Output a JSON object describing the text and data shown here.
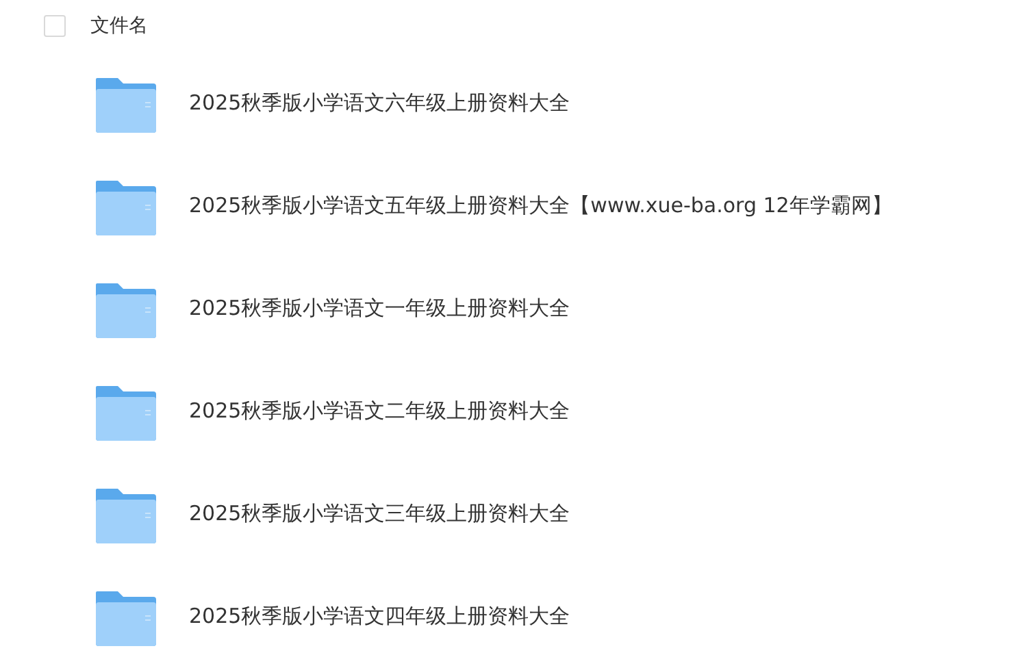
{
  "header": {
    "checked": false,
    "label": "文件名"
  },
  "files": [
    {
      "name": "2025秋季版小学语文六年级上册资料大全"
    },
    {
      "name": "2025秋季版小学语文五年级上册资料大全【www.xue-ba.org 12年学霸网】"
    },
    {
      "name": "2025秋季版小学语文一年级上册资料大全"
    },
    {
      "name": "2025秋季版小学语文二年级上册资料大全"
    },
    {
      "name": "2025秋季版小学语文三年级上册资料大全"
    },
    {
      "name": "2025秋季版小学语文四年级上册资料大全"
    }
  ]
}
